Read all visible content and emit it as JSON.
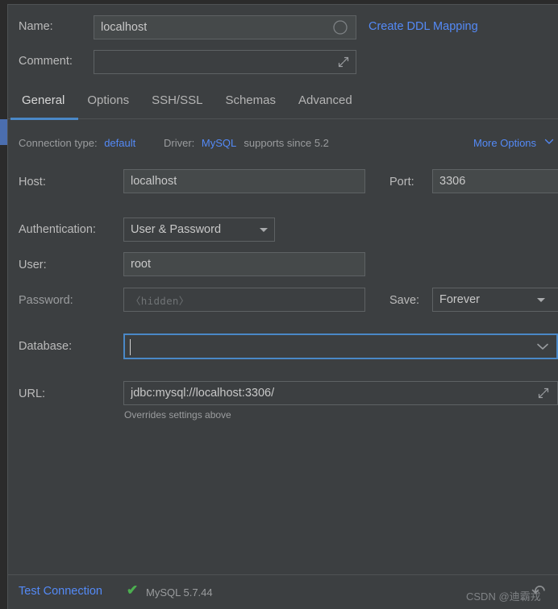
{
  "window": {
    "background": "#3c3f41",
    "accent": "#4a88c7",
    "link_color": "#548af7"
  },
  "header": {
    "name_label": "Name:",
    "name_value": "localhost",
    "name_icon": "circle-icon",
    "comment_label": "Comment:",
    "comment_value": "",
    "comment_icon": "expand-diagonal-icon",
    "create_ddl_mapping_link": "Create DDL Mapping"
  },
  "tabs": [
    {
      "label": "General",
      "active": true
    },
    {
      "label": "Options",
      "active": false
    },
    {
      "label": "SSH/SSL",
      "active": false
    },
    {
      "label": "Schemas",
      "active": false
    },
    {
      "label": "Advanced",
      "active": false
    }
  ],
  "info_bar": {
    "connection_type_label": "Connection type:",
    "connection_type_value": "default",
    "driver_label": "Driver:",
    "driver_value": "MySQL",
    "driver_note": "supports since 5.2",
    "more_options_label": "More Options",
    "more_options_icon": "chevron-down-icon"
  },
  "form": {
    "host_label": "Host:",
    "host_value": "localhost",
    "port_label": "Port:",
    "port_value": "3306",
    "authentication_label": "Authentication:",
    "authentication_value": "User & Password",
    "authentication_icon": "triangle-down-icon",
    "user_label": "User:",
    "user_value": "root",
    "password_label": "Password:",
    "password_placeholder": "〈hidden〉",
    "save_label": "Save:",
    "save_value": "Forever",
    "save_icon": "triangle-down-icon",
    "database_label": "Database:",
    "database_value": "",
    "database_icon": "chevron-down-icon",
    "url_label": "URL:",
    "url_value": "jdbc:mysql://localhost:3306/",
    "url_icon": "expand-diagonal-icon",
    "url_hint": "Overrides settings above"
  },
  "footer": {
    "test_connection_label": "Test Connection",
    "status_icon": "check-icon",
    "status_color": "#4caf50",
    "server_version": "MySQL 5.7.44",
    "watermark": "CSDN @迪霸戎",
    "watermark_icon": "rotate-arrow-icon"
  }
}
